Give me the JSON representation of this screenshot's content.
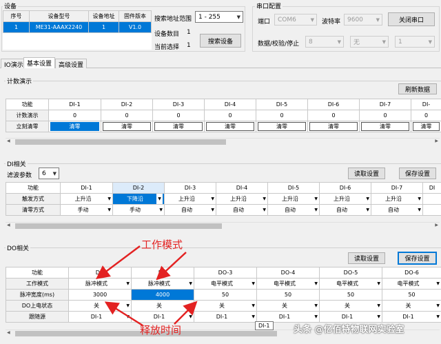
{
  "device_group": {
    "title": "设备",
    "table_headers": [
      "序号",
      "设备型号",
      "设备地址",
      "固件版本"
    ],
    "row": [
      "1",
      "ME31-AAAX2240",
      "1",
      "V1.0"
    ],
    "search_range_label": "搜索地址范围",
    "search_range_value": "1 - 255",
    "device_count_label": "设备数目",
    "device_count_value": "1",
    "current_select_label": "当前选择",
    "current_select_value": "1",
    "search_button": "搜索设备"
  },
  "serial_group": {
    "title": "串口配置",
    "port_label": "端口",
    "port_value": "COM6",
    "baud_label": "波特率",
    "baud_value": "9600",
    "close_button": "关闭串口",
    "format_label": "数据/校验/停止",
    "data_bits": "8",
    "parity": "无",
    "stop_bits": "1"
  },
  "tabs": [
    "IO演示",
    "基本设置",
    "高级设置"
  ],
  "counter_group": {
    "title": "计数演示",
    "refresh_button": "刷新数据",
    "headers": [
      "功能",
      "DI-1",
      "DI-2",
      "DI-3",
      "DI-4",
      "DI-5",
      "DI-6",
      "DI-7",
      "DI-"
    ],
    "rows": [
      {
        "label": "计数演示",
        "cells": [
          "0",
          "0",
          "0",
          "0",
          "0",
          "0",
          "0",
          "0"
        ]
      },
      {
        "label": "立刻清零",
        "cells": [
          "清零",
          "清零",
          "清零",
          "清零",
          "清零",
          "清零",
          "清零",
          "清零"
        ]
      }
    ]
  },
  "di_group": {
    "title": "DI相关",
    "filter_label": "滤波参数",
    "filter_value": "6",
    "read_button": "读取设置",
    "save_button": "保存设置",
    "headers": [
      "功能",
      "DI-1",
      "DI-2",
      "DI-3",
      "DI-4",
      "DI-5",
      "DI-6",
      "DI-7",
      "DI"
    ],
    "rows": [
      {
        "label": "触发方式",
        "cells": [
          "上升沿",
          "下降沿",
          "上升沿",
          "上升沿",
          "上升沿",
          "上升沿",
          "上升沿",
          ""
        ]
      },
      {
        "label": "清零方式",
        "cells": [
          "手动",
          "手动",
          "自动",
          "自动",
          "自动",
          "自动",
          "自动",
          ""
        ]
      }
    ]
  },
  "do_group": {
    "title": "DO相关",
    "read_button": "读取设置",
    "save_button": "保存设置",
    "headers": [
      "功能",
      "DO",
      "DO",
      "DO-3",
      "DO-4",
      "DO-5",
      "DO-6"
    ],
    "rows": [
      {
        "label": "工作模式",
        "cells": [
          "脉冲模式",
          "脉冲模式",
          "电平模式",
          "电平模式",
          "电平模式",
          "电平模式"
        ]
      },
      {
        "label": "脉冲宽度(ms)",
        "cells": [
          "3000",
          "4000",
          "50",
          "50",
          "50",
          "50"
        ]
      },
      {
        "label": "DO上电状态",
        "cells": [
          "关",
          "关",
          "关",
          "关",
          "关",
          "关"
        ]
      },
      {
        "label": "跟随源",
        "cells": [
          "DI-1",
          "DI-1",
          "DI-1",
          "DI-1",
          "DI-1",
          "DI-1"
        ]
      }
    ],
    "tooltip": "DI-1"
  },
  "annotations": {
    "work_mode": "工作模式",
    "release_time": "释放时间",
    "watermark": "头条 @亿佰特物联网实验室"
  },
  "colors": {
    "selection": "#0078d7",
    "annotation": "#e32222"
  }
}
